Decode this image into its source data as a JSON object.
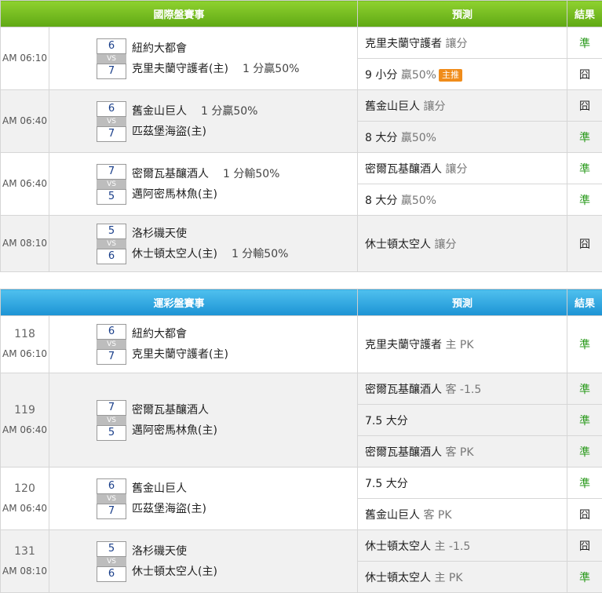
{
  "intl": {
    "header": {
      "match": "國際盤賽事",
      "pred": "預測",
      "res": "結果"
    },
    "games": [
      {
        "time": "AM 06:10",
        "away": "紐約大都會",
        "home": "克里夫蘭守護者(主)",
        "away_score": "6",
        "home_score": "7",
        "handicap": "1 分贏50%",
        "handicap_row": "home",
        "preds": [
          {
            "main": "克里夫蘭守護者",
            "sub": "讓分",
            "tag": "",
            "res": "準"
          },
          {
            "main": "9 小分",
            "sub": "贏50%",
            "tag": "主推",
            "res": "囧"
          }
        ]
      },
      {
        "time": "AM 06:40",
        "away": "舊金山巨人",
        "home": "匹茲堡海盜(主)",
        "away_score": "6",
        "home_score": "7",
        "handicap": "1 分贏50%",
        "handicap_row": "away",
        "preds": [
          {
            "main": "舊金山巨人",
            "sub": "讓分",
            "tag": "",
            "res": "囧"
          },
          {
            "main": "8 大分",
            "sub": "贏50%",
            "tag": "",
            "res": "準"
          }
        ]
      },
      {
        "time": "AM 06:40",
        "away": "密爾瓦基釀酒人",
        "home": "邁阿密馬林魚(主)",
        "away_score": "7",
        "home_score": "5",
        "handicap": "1 分輸50%",
        "handicap_row": "away",
        "preds": [
          {
            "main": "密爾瓦基釀酒人",
            "sub": "讓分",
            "tag": "",
            "res": "準"
          },
          {
            "main": "8 大分",
            "sub": "贏50%",
            "tag": "",
            "res": "準"
          }
        ]
      },
      {
        "time": "AM 08:10",
        "away": "洛杉磯天使",
        "home": "休士頓太空人(主)",
        "away_score": "5",
        "home_score": "6",
        "handicap": "1 分輸50%",
        "handicap_row": "home",
        "preds": [
          {
            "main": "休士頓太空人",
            "sub": "讓分",
            "tag": "",
            "res": "囧"
          }
        ]
      }
    ]
  },
  "lottery": {
    "header": {
      "match": "運彩盤賽事",
      "pred": "預測",
      "res": "結果"
    },
    "games": [
      {
        "num": "118",
        "time": "AM 06:10",
        "away": "紐約大都會",
        "home": "克里夫蘭守護者(主)",
        "away_score": "6",
        "home_score": "7",
        "preds": [
          {
            "main": "克里夫蘭守護者",
            "sub": "主 PK",
            "res": "準"
          }
        ]
      },
      {
        "num": "119",
        "time": "AM 06:40",
        "away": "密爾瓦基釀酒人",
        "home": "邁阿密馬林魚(主)",
        "away_score": "7",
        "home_score": "5",
        "preds": [
          {
            "main": "密爾瓦基釀酒人",
            "sub": "客 -1.5",
            "res": "準"
          },
          {
            "main": "7.5 大分",
            "sub": "",
            "res": "準"
          },
          {
            "main": "密爾瓦基釀酒人",
            "sub": "客 PK",
            "res": "準"
          }
        ]
      },
      {
        "num": "120",
        "time": "AM 06:40",
        "away": "舊金山巨人",
        "home": "匹茲堡海盜(主)",
        "away_score": "6",
        "home_score": "7",
        "preds": [
          {
            "main": "7.5 大分",
            "sub": "",
            "res": "準"
          },
          {
            "main": "舊金山巨人",
            "sub": "客 PK",
            "res": "囧"
          }
        ]
      },
      {
        "num": "131",
        "time": "AM 08:10",
        "away": "洛杉磯天使",
        "home": "休士頓太空人(主)",
        "away_score": "5",
        "home_score": "6",
        "preds": [
          {
            "main": "休士頓太空人",
            "sub": "主 -1.5",
            "res": "囧"
          },
          {
            "main": "休士頓太空人",
            "sub": "主 PK",
            "res": "準"
          }
        ]
      }
    ]
  },
  "colors": {
    "win": "#2a9a1c",
    "lose": "#222222",
    "intl_header": "#6cb81c",
    "lottery_header": "#2aa3e0",
    "tag": "#f08c1a"
  }
}
